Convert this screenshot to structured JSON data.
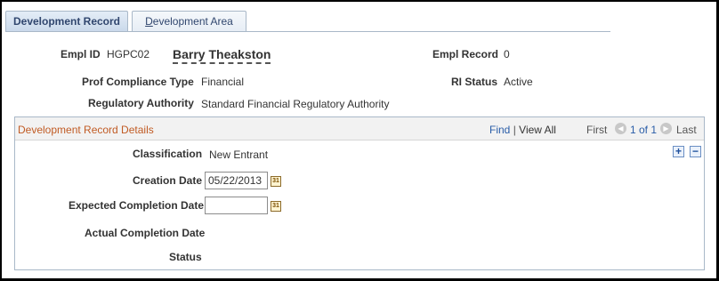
{
  "tabs": [
    {
      "label": "Development Record",
      "active": true
    },
    {
      "label_first": "D",
      "label_rest": "evelopment Area",
      "active": false
    }
  ],
  "header": {
    "empl_id_label": "Empl ID",
    "empl_id_value": "HGPC02",
    "empl_name": "Barry Theakston",
    "empl_record_label": "Empl Record",
    "empl_record_value": "0",
    "prof_compliance_label": "Prof Compliance Type",
    "prof_compliance_value": "Financial",
    "ri_status_label": "RI Status",
    "ri_status_value": "Active",
    "regulatory_label": "Regulatory Authority",
    "regulatory_value": "Standard Financial Regulatory Authority"
  },
  "section": {
    "title": "Development Record Details",
    "find": "Find",
    "separator": "|",
    "view_all": "View All",
    "first": "First",
    "range": "1 of 1",
    "last": "Last",
    "add_symbol": "+",
    "remove_symbol": "−"
  },
  "details": {
    "classification_label": "Classification",
    "classification_value": "New Entrant",
    "creation_label": "Creation Date",
    "creation_value": "05/22/2013",
    "expected_label": "Expected Completion Date",
    "expected_value": "",
    "actual_label": "Actual Completion Date",
    "status_label": "Status"
  },
  "icons": {
    "calendar": "calendar-icon",
    "prev": "previous-arrow-icon",
    "next": "next-arrow-icon"
  },
  "colors": {
    "section_title": "#c15b24",
    "link": "#2a5da8",
    "tab_text": "#30466e"
  }
}
